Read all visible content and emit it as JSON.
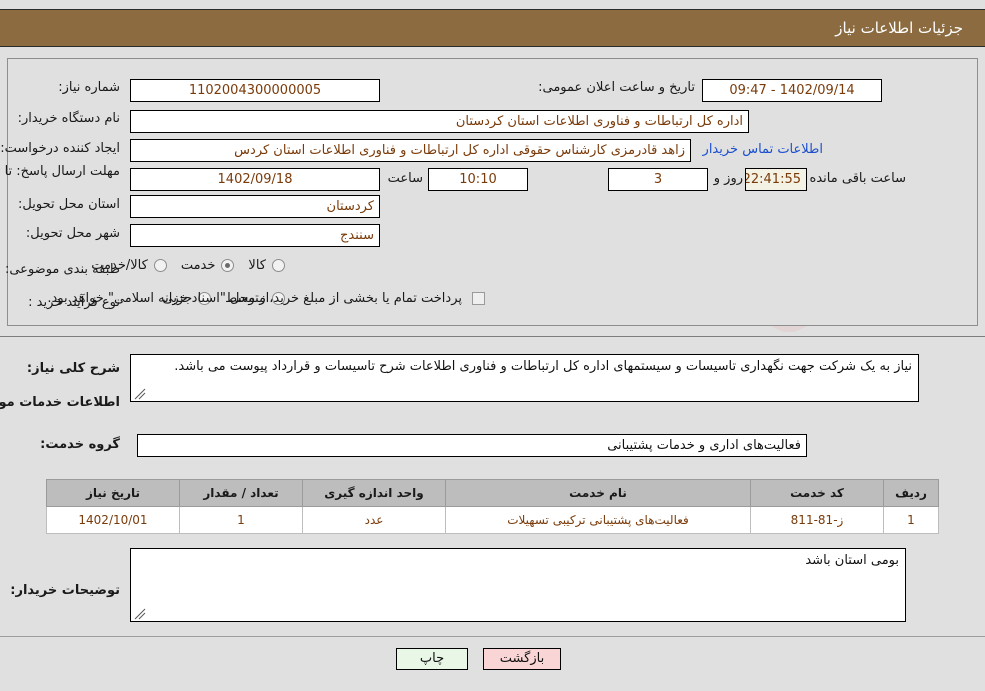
{
  "header": {
    "title": "جزئیات اطلاعات نیاز"
  },
  "form": {
    "need_number_label": "شماره نیاز:",
    "need_number_value": "1102004300000005",
    "announce_datetime_label": "تاریخ و ساعت اعلان عمومی:",
    "announce_datetime_value": "1402/09/14 - 09:47",
    "buyer_org_label": "نام دستگاه خریدار:",
    "buyer_org_value": "اداره کل ارتباطات و فناوری اطلاعات استان کردستان",
    "requester_label": "ایجاد کننده درخواست:",
    "requester_value": "زاهد قادرمزی کارشناس حقوقی اداره کل ارتباطات و فناوری اطلاعات استان کردس",
    "contact_link": "اطلاعات تماس خریدار",
    "deadline_label": "مهلت ارسال پاسخ: تا تاریخ:",
    "deadline_date": "1402/09/18",
    "deadline_hour_label": "ساعت",
    "deadline_hour": "10:10",
    "remaining_days": "3",
    "remaining_days_suffix": "روز و",
    "remaining_time": "22:41:55",
    "remaining_suffix": "ساعت باقی مانده",
    "province_label": "استان محل تحویل:",
    "province_value": "کردستان",
    "city_label": "شهر محل تحویل:",
    "city_value": "سنندج",
    "category_label": "طبقه بندی موضوعی:",
    "category_options": [
      {
        "label": "کالا",
        "checked": false
      },
      {
        "label": "خدمت",
        "checked": true
      },
      {
        "label": "کالا/خدمت",
        "checked": false
      }
    ],
    "process_label": "نوع فرآیند خرید :",
    "process_options": [
      {
        "label": "متوسط",
        "checked": false
      },
      {
        "label": "جزیی",
        "checked": false
      }
    ],
    "treasury_checkbox_checked": false,
    "treasury_text": "پرداخت تمام یا بخشی از مبلغ خرید،از محل \"اسناد خزانه اسلامی\" خواهد بود."
  },
  "need_summary": {
    "label": "شرح کلی نیاز:",
    "text": "نیاز به یک شرکت جهت نگهداری تاسیسات و سیستمهای اداره کل ارتباطات و فناوری اطلاعات شرح تاسیسات و قرارداد پیوست می باشد."
  },
  "services_section": {
    "heading": "اطلاعات خدمات مورد نیاز",
    "group_label": "گروه خدمت:",
    "group_value": "فعالیت‌های اداری و خدمات پشتیبانی",
    "table": {
      "columns": [
        "ردیف",
        "کد خدمت",
        "نام خدمت",
        "واحد اندازه گیری",
        "تعداد / مقدار",
        "تاریخ نیاز"
      ],
      "rows": [
        {
          "index": "1",
          "code": "ز-81-811",
          "name": "فعالیت‌های پشتیبانی ترکیبی تسهیلات",
          "unit": "عدد",
          "quantity": "1",
          "need_date": "1402/10/01"
        }
      ]
    }
  },
  "buyer_notes": {
    "label": "توضیحات خریدار:",
    "text": "بومی استان باشد"
  },
  "footer": {
    "print_label": "چاپ",
    "back_label": "بازگشت"
  },
  "watermark": {
    "text": "AriaTender.net"
  }
}
